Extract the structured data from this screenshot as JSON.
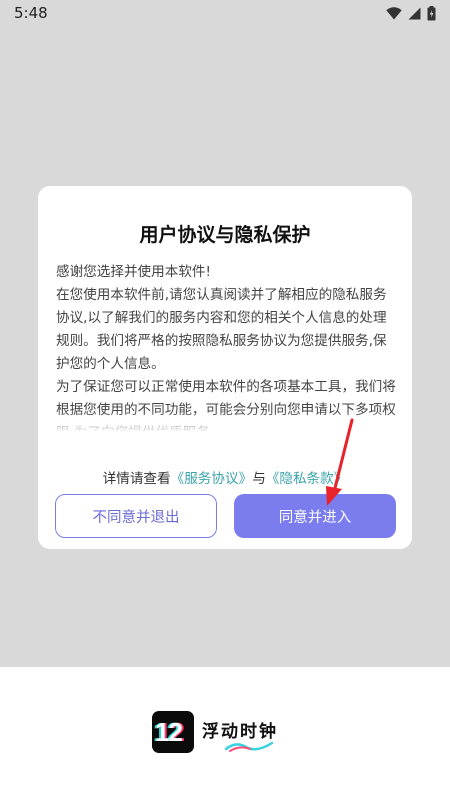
{
  "status_bar": {
    "time": "5:48"
  },
  "dialog": {
    "title": "用户协议与隐私保护",
    "paragraphs": [
      "感谢您选择并使用本软件!",
      "在您使用本软件前,请您认真阅读并了解相应的隐私服务协议,以了解我们的服务内容和您的相关个人信息的处理规则。我们将严格的按照隐私服务协议为您提供服务,保护您的个人信息。",
      "为了保证您可以正常使用本软件的各项基本工具，我们将根据您使用的不同功能，可能会分别向您申请以下多项权限,为了向您提供优质服务"
    ],
    "links_prefix": "详情请查看",
    "service_link": "《服务协议》",
    "links_join": "与",
    "privacy_link": "《隐私条款》",
    "decline_label": "不同意并退出",
    "agree_label": "同意并进入"
  },
  "brand": {
    "icon_text": "12",
    "app_name": "浮动时钟"
  },
  "colors": {
    "accent": "#7b7dee",
    "link": "#3aa3a9",
    "arrow": "#e8232a"
  },
  "icons": [
    "wifi-icon",
    "signal-icon",
    "battery-icon",
    "app-logo-icon"
  ]
}
